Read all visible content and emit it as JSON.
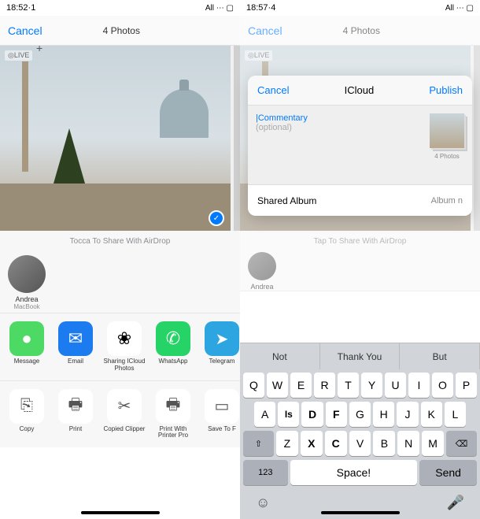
{
  "left": {
    "status": {
      "time": "18:52·1",
      "right": "All ⋯ ▢"
    },
    "header": {
      "cancel": "Cancel",
      "title": "4 Photos"
    },
    "photo": {
      "live": "◎LIVE",
      "plus": "+",
      "check": "✓"
    },
    "airdrop": "Tocca To Share With AirDrop",
    "contact": {
      "name": "Andrea",
      "device": "MacBook"
    },
    "apps": [
      {
        "label": "Message",
        "color": "#4cd964",
        "glyph": "●"
      },
      {
        "label": "Email",
        "color": "#1d7bf0",
        "glyph": "✉"
      },
      {
        "label": "Sharing ICloud Photos",
        "color": "#ffffff",
        "glyph": "❀"
      },
      {
        "label": "WhatsApp",
        "color": "#25d366",
        "glyph": "✆"
      },
      {
        "label": "Telegram",
        "color": "#2ca5e0",
        "glyph": "➤"
      }
    ],
    "actions": [
      {
        "label": "Copy",
        "glyph": "⎘"
      },
      {
        "label": "Print",
        "glyph": "🖶"
      },
      {
        "label": "Copied Clipper",
        "glyph": "✂"
      },
      {
        "label": "Print With Printer Pro",
        "glyph": "🖶"
      },
      {
        "label": "Save To F",
        "glyph": "▭"
      }
    ]
  },
  "right": {
    "status": {
      "time": "18:57·4",
      "right": "All ⋯ ▢"
    },
    "header": {
      "cancel": "Cancel",
      "title": "4 Photos"
    },
    "photo": {
      "live": "◎LIVE"
    },
    "airdrop": "Tap To Share With AirDrop",
    "contact": {
      "name": "Andrea"
    },
    "sheet": {
      "cancel": "Cancel",
      "title": "ICloud",
      "publish": "Publish",
      "comment": "|Commentary",
      "optional": "(optional)",
      "thumb_label": "4 Photos",
      "footer_left": "Shared Album",
      "footer_right": "Album n"
    },
    "suggestions": [
      "Not",
      "Thank You",
      "But"
    ],
    "keyboard": {
      "row1": [
        "Q",
        "W",
        "E",
        "R",
        "T",
        "Y",
        "U",
        "I",
        "O",
        "P"
      ],
      "row2": [
        "A",
        "Is",
        "D",
        "F",
        "G",
        "H",
        "J",
        "K",
        "L"
      ],
      "row3_shift": "⇧",
      "row3": [
        "Z",
        "X",
        "C",
        "V",
        "B",
        "N",
        "M"
      ],
      "row3_del": "⌫",
      "num": "123",
      "space": "Space!",
      "send": "Send",
      "emoji": "☺",
      "mic": "🎤"
    }
  }
}
